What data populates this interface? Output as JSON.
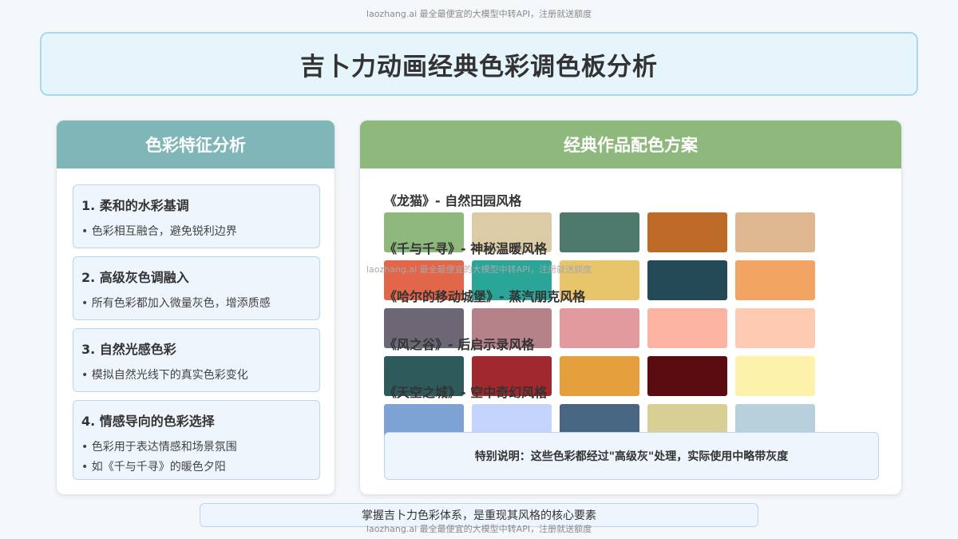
{
  "watermark": "laozhang.ai 最全最便宜的大模型中转API，注册就送额度",
  "title": "吉卜力动画经典色彩调色板分析",
  "left_panel": {
    "header": "色彩特征分析",
    "features": [
      {
        "title": "1. 柔和的水彩基调",
        "points": [
          "色彩相互融合，避免锐利边界"
        ]
      },
      {
        "title": "2. 高级灰色调融入",
        "points": [
          "所有色彩都加入微量灰色，增添质感"
        ]
      },
      {
        "title": "3. 自然光感色彩",
        "points": [
          "模拟自然光线下的真实色彩变化"
        ]
      },
      {
        "title": "4. 情感导向的色彩选择",
        "points": [
          "色彩用于表达情感和场景氛围",
          "如《千与千寻》的暖色夕阳"
        ]
      }
    ]
  },
  "right_panel": {
    "header": "经典作品配色方案",
    "palettes": [
      {
        "title": "《龙猫》- 自然田园风格",
        "colors": [
          "#8fb87c",
          "#dccca5",
          "#4e7a6e",
          "#bd6a26",
          "#dfb892"
        ]
      },
      {
        "title": "《千与千寻》- 神秘温暖风格",
        "colors": [
          "#e2664a",
          "#2aa698",
          "#e8c46a",
          "#254a57",
          "#f2a462"
        ]
      },
      {
        "title": "《哈尔的移动城堡》- 蒸汽朋克风格",
        "colors": [
          "#6c6675",
          "#b6828a",
          "#e39a9e",
          "#fdb4a2",
          "#fdcbb2"
        ]
      },
      {
        "title": "《风之谷》- 后启示录风格",
        "colors": [
          "#2e5a5c",
          "#a1282c",
          "#e3a03d",
          "#5a0c10",
          "#fdf2ab"
        ]
      },
      {
        "title": "《天空之城》- 空中奇幻风格",
        "colors": [
          "#7fa2d5",
          "#c4d4fc",
          "#476681",
          "#d7cf93",
          "#b8d0dc"
        ]
      }
    ],
    "note": "特别说明：这些色彩都经过\"高级灰\"处理，实际使用中略带灰度"
  },
  "footer": "掌握吉卜力色彩体系，是重现其风格的核心要素"
}
